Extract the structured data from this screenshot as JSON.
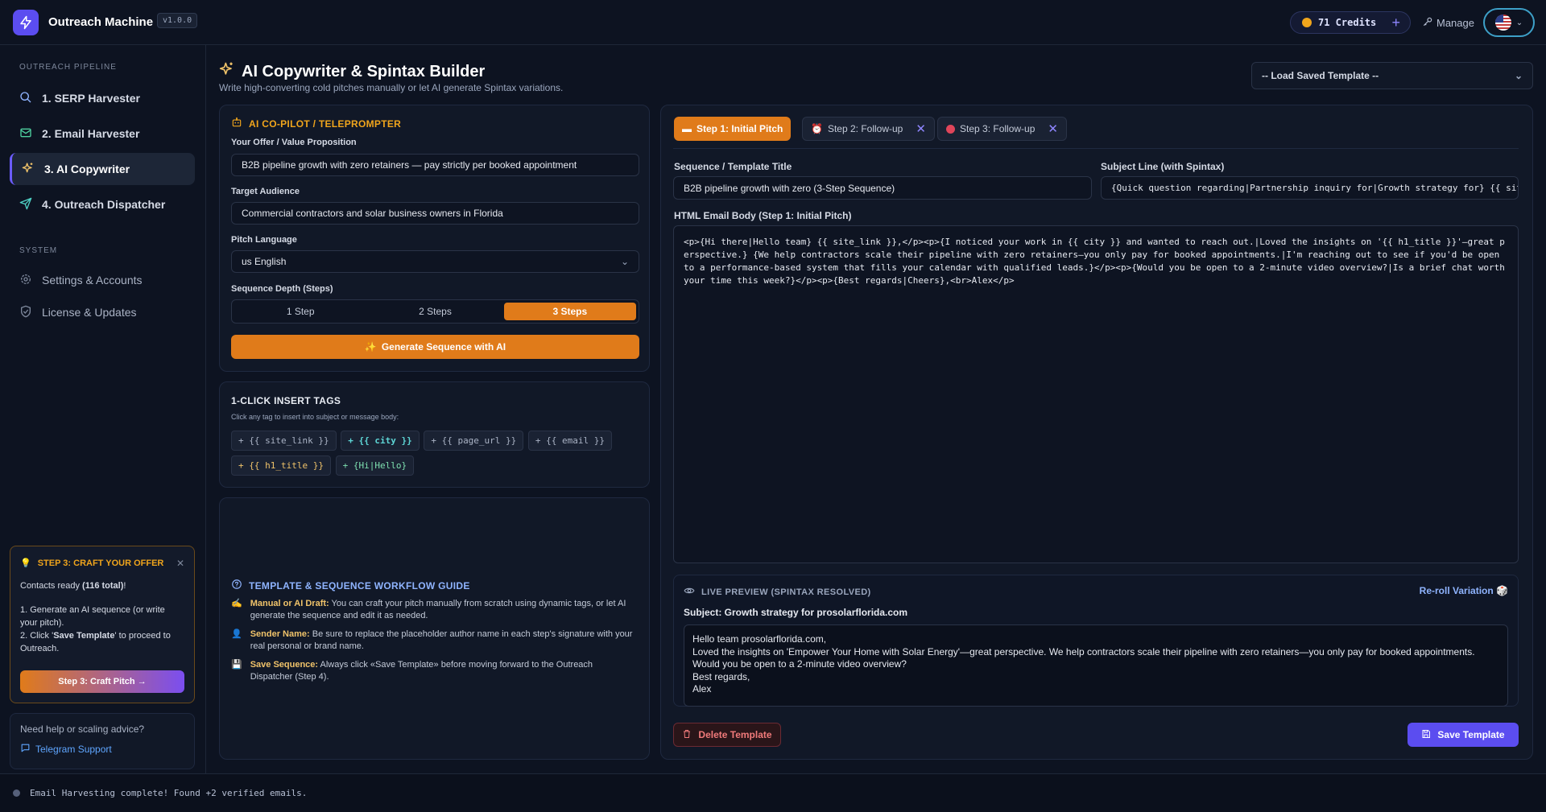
{
  "header": {
    "app_title": "Outreach Machine",
    "version": "v1.0.0",
    "credits": "71 Credits",
    "manage_label": "Manage"
  },
  "sidebar": {
    "pipeline_heading": "OUTREACH PIPELINE",
    "items": [
      {
        "label": "1. SERP Harvester",
        "icon": "search-icon"
      },
      {
        "label": "2. Email Harvester",
        "icon": "mail-icon"
      },
      {
        "label": "3. AI Copywriter",
        "icon": "sparkles-icon"
      },
      {
        "label": "4. Outreach Dispatcher",
        "icon": "send-icon"
      }
    ],
    "system_heading": "SYSTEM",
    "system_items": [
      {
        "label": "Settings & Accounts",
        "icon": "gear-icon"
      },
      {
        "label": "License & Updates",
        "icon": "shield-icon"
      }
    ],
    "tip": {
      "title": "STEP 3: CRAFT YOUR OFFER",
      "contacts_prefix": "Contacts ready ",
      "contacts_count": "(116 total)",
      "contacts_suffix": "!",
      "line1": "1. Generate an AI sequence (or write your pitch).",
      "line2_prefix": "2. Click '",
      "line2_bold": "Save Template",
      "line2_suffix": "' to proceed to Outreach.",
      "button": "Step 3: Craft Pitch →"
    },
    "help": {
      "question": "Need help or scaling advice?",
      "link": "Telegram Support"
    }
  },
  "page": {
    "title": "AI Copywriter & Spintax Builder",
    "subtitle": "Write high-converting cold pitches manually or let AI generate Spintax variations.",
    "load_template": "-- Load Saved Template --"
  },
  "copilot": {
    "heading": "AI CO-PILOT / TELEPROMPTER",
    "offer_label": "Your Offer / Value Proposition",
    "offer_value": "B2B pipeline growth with zero retainers — pay strictly per booked appointment",
    "audience_label": "Target Audience",
    "audience_value": "Commercial contractors and solar business owners in Florida",
    "language_label": "Pitch Language",
    "language_value": "us English",
    "depth_label": "Sequence Depth (Steps)",
    "depth_options": [
      "1 Step",
      "2 Steps",
      "3 Steps"
    ],
    "generate_button": "Generate Sequence with AI"
  },
  "insert_tags": {
    "heading": "1-CLICK INSERT TAGS",
    "hint": "Click any tag to insert into subject or message body:",
    "tags": [
      "+ {{ site_link }}",
      "+ {{ city }}",
      "+ {{ page_url }}",
      "+ {{ email }}",
      "+ {{ h1_title }}",
      "+ {Hi|Hello}"
    ]
  },
  "guide": {
    "heading": "TEMPLATE & SEQUENCE WORKFLOW GUIDE",
    "rows": [
      {
        "icon": "writing-hand-icon",
        "bold": "Manual or AI Draft:",
        "text": " You can craft your pitch manually from scratch using dynamic tags, or let AI generate the sequence and edit it as needed."
      },
      {
        "icon": "user-icon",
        "bold": "Sender Name:",
        "text": " Be sure to replace the placeholder author name in each step's signature with your real personal or brand name."
      },
      {
        "icon": "floppy-icon",
        "bold": "Save Sequence:",
        "text": " Always click «Save Template» before moving forward to the Outreach Dispatcher (Step 4)."
      }
    ]
  },
  "editor": {
    "tabs": [
      {
        "label": "Step 1: Initial Pitch",
        "icon": "memo-icon"
      },
      {
        "label": "Step 2: Follow-up",
        "icon": "alarm-icon"
      },
      {
        "label": "Step 3: Follow-up",
        "icon": "red-circle-icon"
      }
    ],
    "title_label": "Sequence / Template Title",
    "title_value": "B2B pipeline growth with zero  (3-Step Sequence)",
    "subject_label": "Subject Line (with Spintax)",
    "subject_value": "{Quick question regarding|Partnership inquiry for|Growth strategy for} {{ site_link }}",
    "body_label": "HTML Email Body (Step 1: Initial Pitch)",
    "body_value": "<p>{Hi there|Hello team} {{ site_link }},</p><p>{I noticed your work in {{ city }} and wanted to reach out.|Loved the insights on '{{ h1_title }}'—great perspective.} {We help contractors scale their pipeline with zero retainers—you only pay for booked appointments.|I'm reaching out to see if you'd be open to a performance-based system that fills your calendar with qualified leads.}</p><p>{Would you be open to a 2-minute video overview?|Is a brief chat worth your time this week?}</p><p>{Best regards|Cheers},<br>Alex</p>",
    "preview_heading": "LIVE PREVIEW (SPINTAX RESOLVED)",
    "reroll": "Re-roll Variation",
    "preview_subject": "Subject: Growth strategy for prosolarflorida.com",
    "preview_body": "Hello team prosolarflorida.com,\nLoved the insights on 'Empower Your Home with Solar Energy'—great perspective. We help contractors scale their pipeline with zero retainers—you only pay for booked appointments.\nWould you be open to a 2-minute video overview?\nBest regards,\nAlex",
    "delete_button": "Delete Template",
    "save_button": "Save Template"
  },
  "status": {
    "message": "Email Harvesting complete! Found +2 verified emails."
  },
  "colors": {
    "accent": "#e07b1a",
    "primary": "#5b4df0",
    "background": "#0d1321"
  }
}
